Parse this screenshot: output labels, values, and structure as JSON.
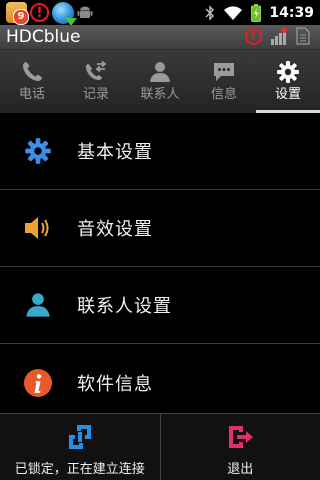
{
  "status_bar": {
    "notification_count": "9",
    "time": "14:39",
    "icons": [
      "app-notification-icon",
      "warning-icon",
      "globe-download-icon",
      "android-icon",
      "bluetooth-icon",
      "wifi-icon",
      "battery-icon"
    ]
  },
  "title_bar": {
    "title": "HDCblue",
    "icons": [
      "warning-icon",
      "signal-icon",
      "sim-icon"
    ]
  },
  "tabs": [
    {
      "label": "电话",
      "icon": "phone-icon",
      "active": false
    },
    {
      "label": "记录",
      "icon": "call-log-icon",
      "active": false
    },
    {
      "label": "联系人",
      "icon": "contact-icon",
      "active": false
    },
    {
      "label": "信息",
      "icon": "message-icon",
      "active": false
    },
    {
      "label": "设置",
      "icon": "gear-icon",
      "active": true
    }
  ],
  "settings_items": [
    {
      "label": "基本设置",
      "icon": "gear-icon",
      "color": "#3d8ee8"
    },
    {
      "label": "音效设置",
      "icon": "speaker-icon",
      "color": "#f0a030"
    },
    {
      "label": "联系人设置",
      "icon": "contact-icon",
      "color": "#3aa8c8"
    },
    {
      "label": "软件信息",
      "icon": "info-icon",
      "color": "#e85a2a"
    }
  ],
  "bottom_bar": {
    "connect_label": "已锁定，正在建立连接",
    "exit_label": "退出",
    "connect_color": "#2a8ee0",
    "exit_color": "#e03070"
  }
}
